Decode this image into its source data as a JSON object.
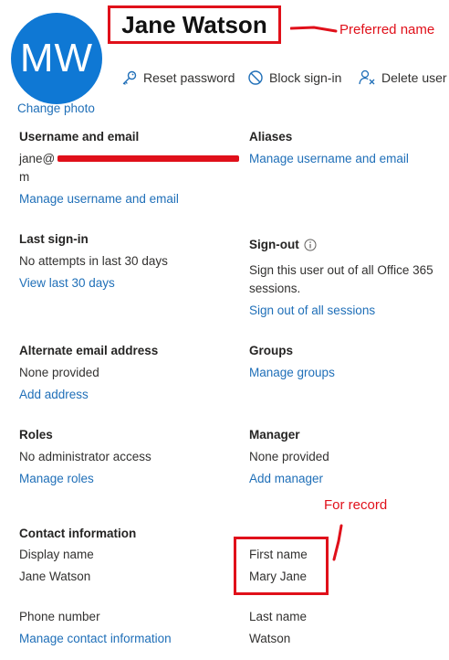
{
  "profile": {
    "initials": "MW",
    "display_name": "Jane Watson",
    "change_photo": "Change photo"
  },
  "actions": {
    "reset_password": "Reset password",
    "block_signin": "Block sign-in",
    "delete_user": "Delete user"
  },
  "annotations": {
    "preferred_name": "Preferred name",
    "for_record": "For record",
    "color": "#e0101a"
  },
  "username": {
    "heading": "Username and email",
    "email_start": "jane@",
    "email_end": "m",
    "link": "Manage username and email"
  },
  "aliases": {
    "heading": "Aliases",
    "link": "Manage username and email"
  },
  "last_signin": {
    "heading": "Last sign-in",
    "value": "No attempts in last 30 days",
    "link": "View last 30 days"
  },
  "signout": {
    "heading": "Sign-out",
    "value_line1": "Sign this user out of all Office 365",
    "value_line2": "sessions.",
    "link": "Sign out of all sessions"
  },
  "alt_email": {
    "heading": "Alternate email address",
    "value": "None provided",
    "link": "Add address"
  },
  "groups": {
    "heading": "Groups",
    "link": "Manage groups"
  },
  "roles": {
    "heading": "Roles",
    "value": "No administrator access",
    "link": "Manage roles"
  },
  "manager": {
    "heading": "Manager",
    "value": "None provided",
    "link": "Add manager"
  },
  "contact": {
    "heading": "Contact information",
    "display_name_label": "Display name",
    "display_name_value": "Jane Watson",
    "first_name_label": "First name",
    "first_name_value": "Mary Jane",
    "phone_label": "Phone number",
    "phone_link": "Manage contact information",
    "last_name_label": "Last name",
    "last_name_value": "Watson"
  },
  "colors": {
    "accent": "#0f78d4",
    "link": "#1f6fb8",
    "annotation": "#e0101a"
  }
}
